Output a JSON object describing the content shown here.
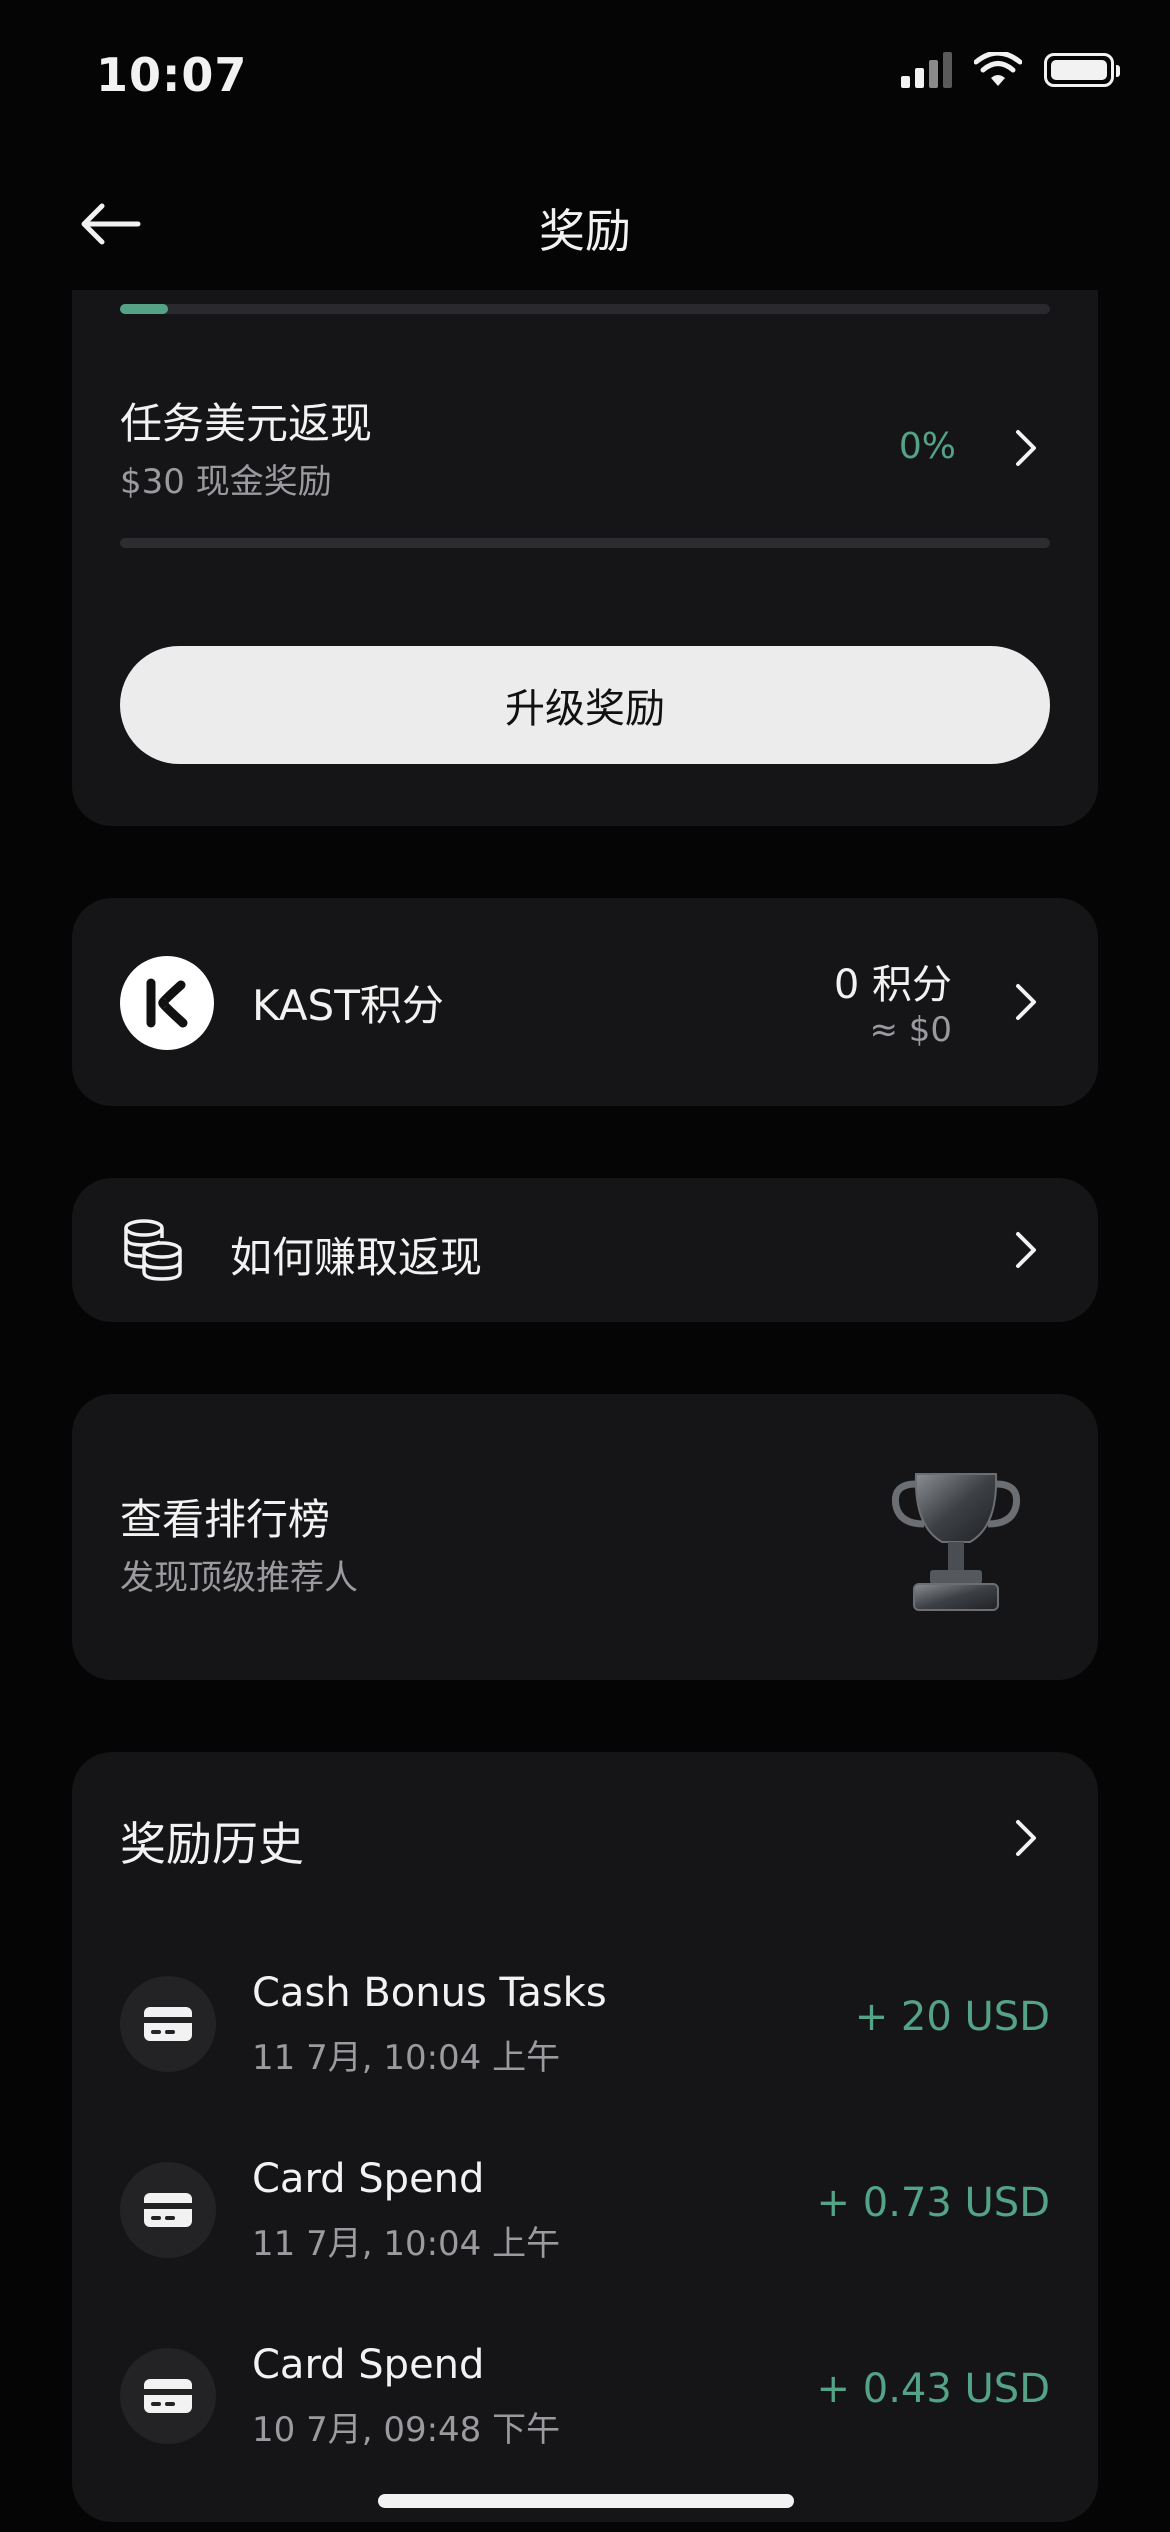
{
  "status_bar": {
    "time": "10:07",
    "icons": [
      "signal-icon",
      "wifi-icon",
      "battery-icon"
    ]
  },
  "nav": {
    "title": "奖励",
    "back_icon": "arrow-left-icon"
  },
  "task": {
    "title": "任务美元返现",
    "subtitle": "$30 现金奖励",
    "percent": "0%",
    "progress_fraction": 0.0
  },
  "upgrade_button": "升级奖励",
  "kast": {
    "label": "KAST积分",
    "points": "0 积分",
    "usd_equivalent": "≈ $0"
  },
  "earn": {
    "label": "如何赚取返现",
    "icon": "coins-stack-icon"
  },
  "leaderboard": {
    "title": "查看排行榜",
    "subtitle": "发现顶级推荐人",
    "icon": "trophy-icon"
  },
  "history": {
    "title": "奖励历史",
    "items": [
      {
        "title": "Cash Bonus Tasks",
        "date": "11 7月, 10:04 上午",
        "amount": "+ 20 USD"
      },
      {
        "title": "Card Spend",
        "date": "11 7月, 10:04 上午",
        "amount": "+ 0.73 USD"
      },
      {
        "title": "Card Spend",
        "date": "10 7月, 09:48 下午",
        "amount": "+ 0.43 USD"
      }
    ]
  },
  "colors": {
    "background": "#050505",
    "card": "#151517",
    "accent_green": "#54a386",
    "muted_text": "#9a9a9f"
  }
}
